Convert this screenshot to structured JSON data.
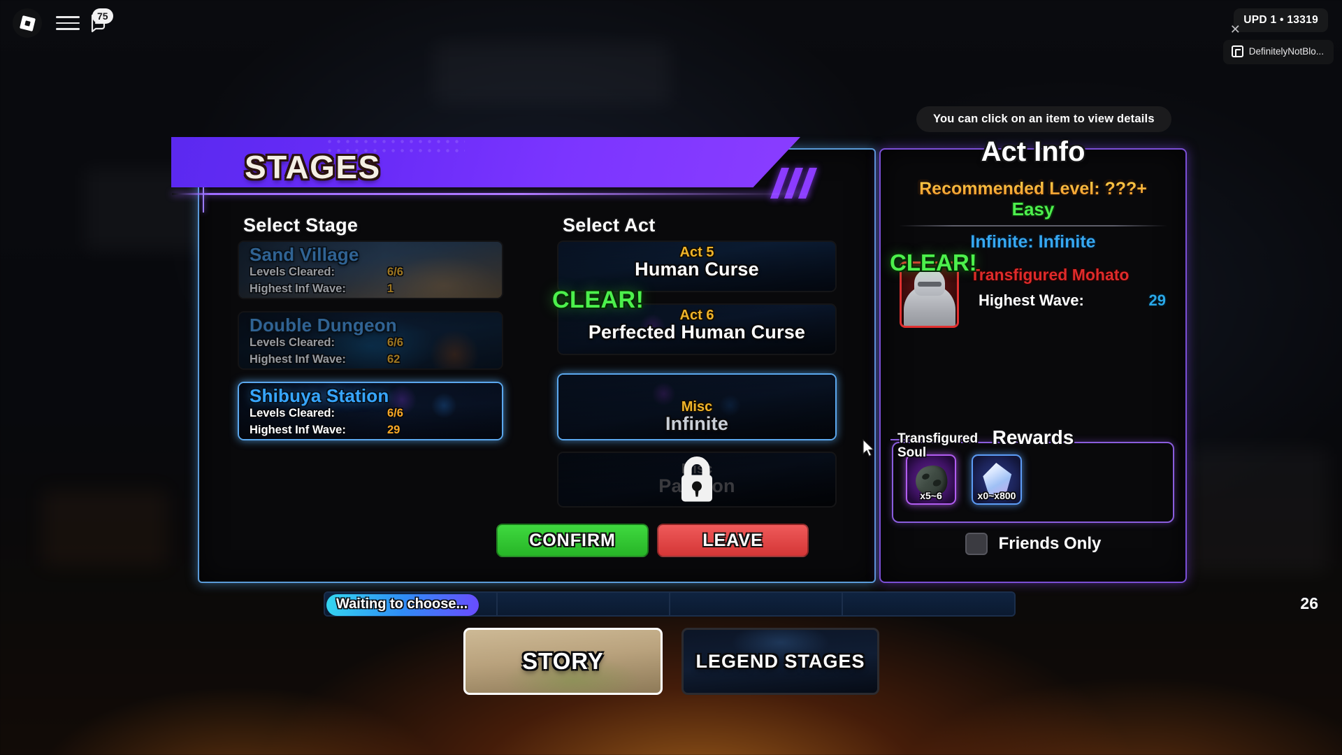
{
  "topbar": {
    "logo_icon": "roblox-logo-icon",
    "menu_icon": "hamburger-menu-icon",
    "chat_icon": "chat-bubble-icon",
    "chat_badge": "75",
    "update_badge": "UPD 1 • 13319",
    "notification": {
      "close_icon": "close-icon",
      "favicon": "app-favicon-icon",
      "label": "DefinitelyNotBlo..."
    }
  },
  "hint": {
    "text": "You can click on an item to view details"
  },
  "banner": {
    "title": "STAGES"
  },
  "main": {
    "stage_column_heading": "Select Stage",
    "act_column_heading": "Select Act",
    "stages": [
      {
        "name": "Sand Village",
        "levels_label": "Levels Cleared:",
        "levels_value": "6/6",
        "wave_label": "Highest Inf Wave:",
        "wave_value": "1",
        "selected": false
      },
      {
        "name": "Double Dungeon",
        "levels_label": "Levels Cleared:",
        "levels_value": "6/6",
        "wave_label": "Highest Inf Wave:",
        "wave_value": "62",
        "selected": false
      },
      {
        "name": "Shibuya Station",
        "levels_label": "Levels Cleared:",
        "levels_value": "6/6",
        "wave_label": "Highest Inf Wave:",
        "wave_value": "29",
        "selected": true
      }
    ],
    "acts": [
      {
        "act_number": "Act 5",
        "act_name": "Human Curse",
        "clear_badge": "",
        "selected": false,
        "locked": false
      },
      {
        "act_number": "Act 6",
        "act_name": "Perfected Human Curse",
        "clear_badge": "CLEAR!",
        "selected": false,
        "locked": false
      },
      {
        "act_number": "Misc",
        "act_name": "Infinite",
        "clear_badge": "",
        "selected": true,
        "locked": false
      },
      {
        "act_number": "Misc",
        "act_name": "Paragon",
        "clear_badge": "",
        "selected": false,
        "locked": true,
        "lock_icon": "padlock-icon"
      }
    ],
    "confirm_label": "CONFIRM",
    "leave_label": "LEAVE"
  },
  "info": {
    "title": "Act Info",
    "recommended_level": "Recommended Level: ???+",
    "difficulty": "Easy",
    "act_subtitle": "Infinite: Infinite",
    "boss_clear_badge": "CLEAR!",
    "boss_name": "Transfigured Mohato",
    "highest_wave_label": "Highest Wave:",
    "highest_wave_value": "29",
    "rewards_title": "Rewards",
    "reward_tooltip": "Transfigured Soul",
    "rewards": [
      {
        "icon": "soul-rock-icon",
        "quantity": "x5~6"
      },
      {
        "icon": "gem-crystal-icon",
        "quantity": "x0~x800"
      }
    ],
    "friends_only_label": "Friends Only",
    "friends_only_checked": false
  },
  "statusbar": {
    "waiting_text": "Waiting to choose...",
    "count": "26",
    "slots": 4
  },
  "tabs": [
    {
      "label": "STORY",
      "selected": true
    },
    {
      "label": "LEGEND STAGES",
      "selected": false
    }
  ],
  "cursor": {
    "icon": "mouse-pointer-icon"
  },
  "colors": {
    "banner_purple": "#7b35ff",
    "panel_border_blue": "#5a9bd8",
    "info_border_purple": "#7b4fd6",
    "clear_green": "#4cf04c",
    "confirm_green": "#3fd93f",
    "leave_red": "#ef5a5a",
    "act_gold": "#f0b429",
    "stage_blue": "#2f9bf0",
    "boss_red": "#e02a2a",
    "wave_cyan": "#29a8e8"
  }
}
